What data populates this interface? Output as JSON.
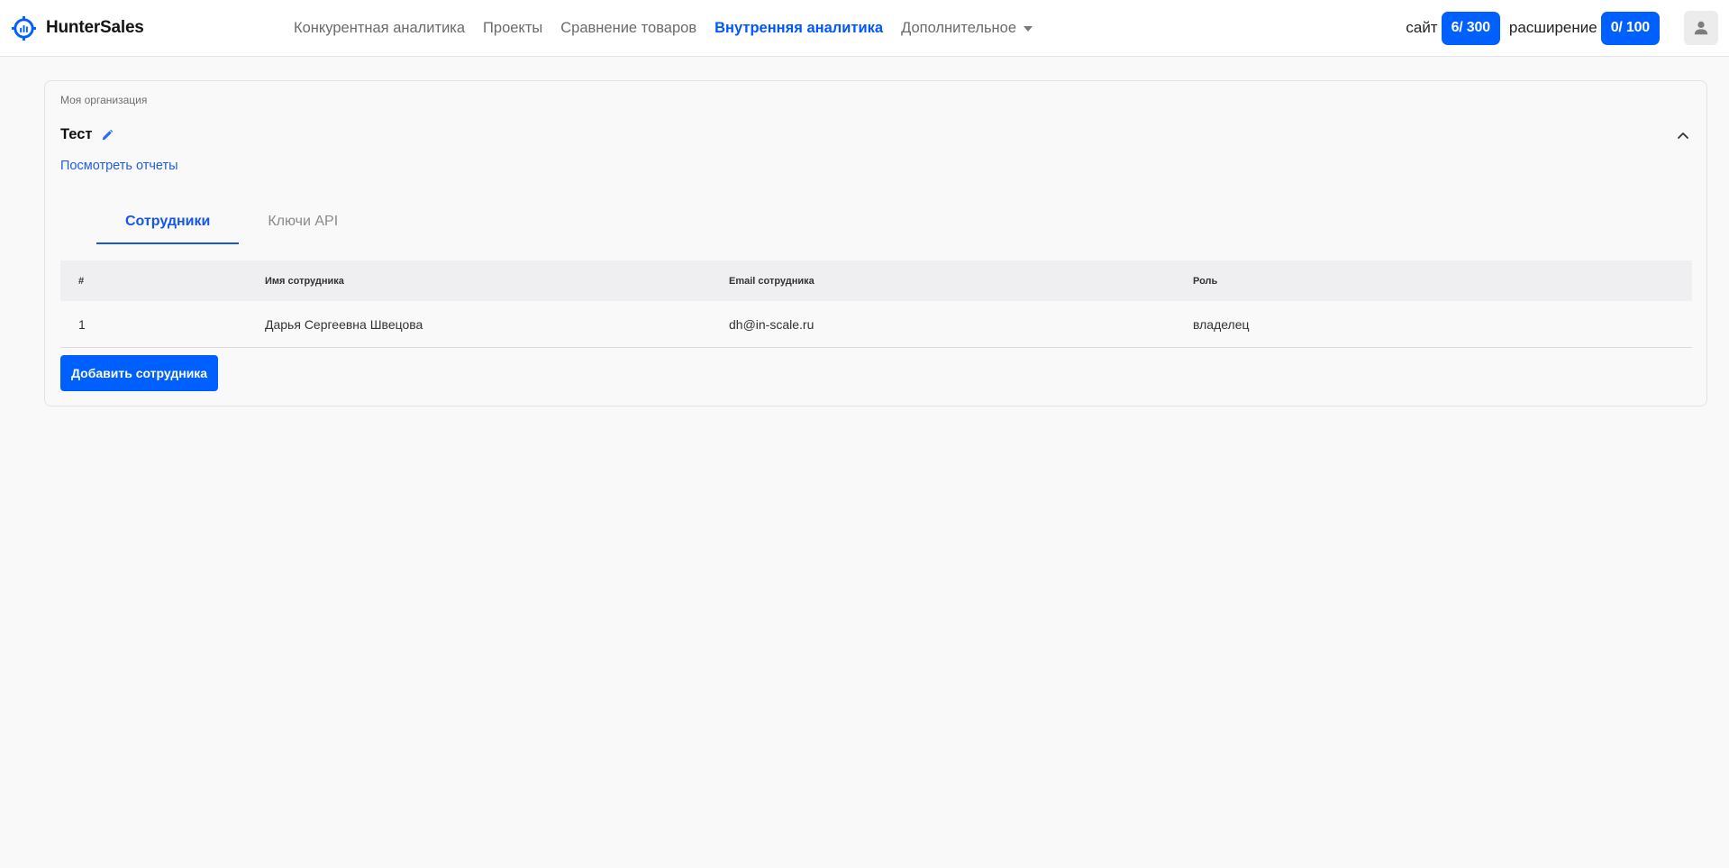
{
  "header": {
    "logo_text": "HunterSales",
    "nav": [
      {
        "label": "Конкурентная аналитика",
        "active": false
      },
      {
        "label": "Проекты",
        "active": false
      },
      {
        "label": "Сравнение товаров",
        "active": false
      },
      {
        "label": "Внутренняя аналитика",
        "active": true
      },
      {
        "label": "Дополнительное",
        "active": false,
        "has_dropdown": true
      }
    ],
    "limits": {
      "site_label": "сайт",
      "site_value": "6/ 300",
      "extension_label": "расширение",
      "extension_value": "0/ 100"
    },
    "user_icon": "user-icon"
  },
  "organization": {
    "caption": "Моя организация",
    "name": "Тест",
    "reports_link": "Посмотреть отчеты"
  },
  "tabs": [
    {
      "label": "Сотрудники",
      "active": true
    },
    {
      "label": "Ключи API",
      "active": false
    }
  ],
  "table": {
    "columns": [
      "#",
      "Имя сотрудника",
      "Email сотрудника",
      "Роль"
    ],
    "rows": [
      [
        "1",
        "Дарья Сергеевна Швецова",
        "dh@in-scale.ru",
        "владелец"
      ]
    ]
  },
  "add_button": "Добавить сотрудника",
  "colors": {
    "accent": "#0060ff",
    "active_nav": "#0057ff",
    "link": "#1f5fe0"
  }
}
